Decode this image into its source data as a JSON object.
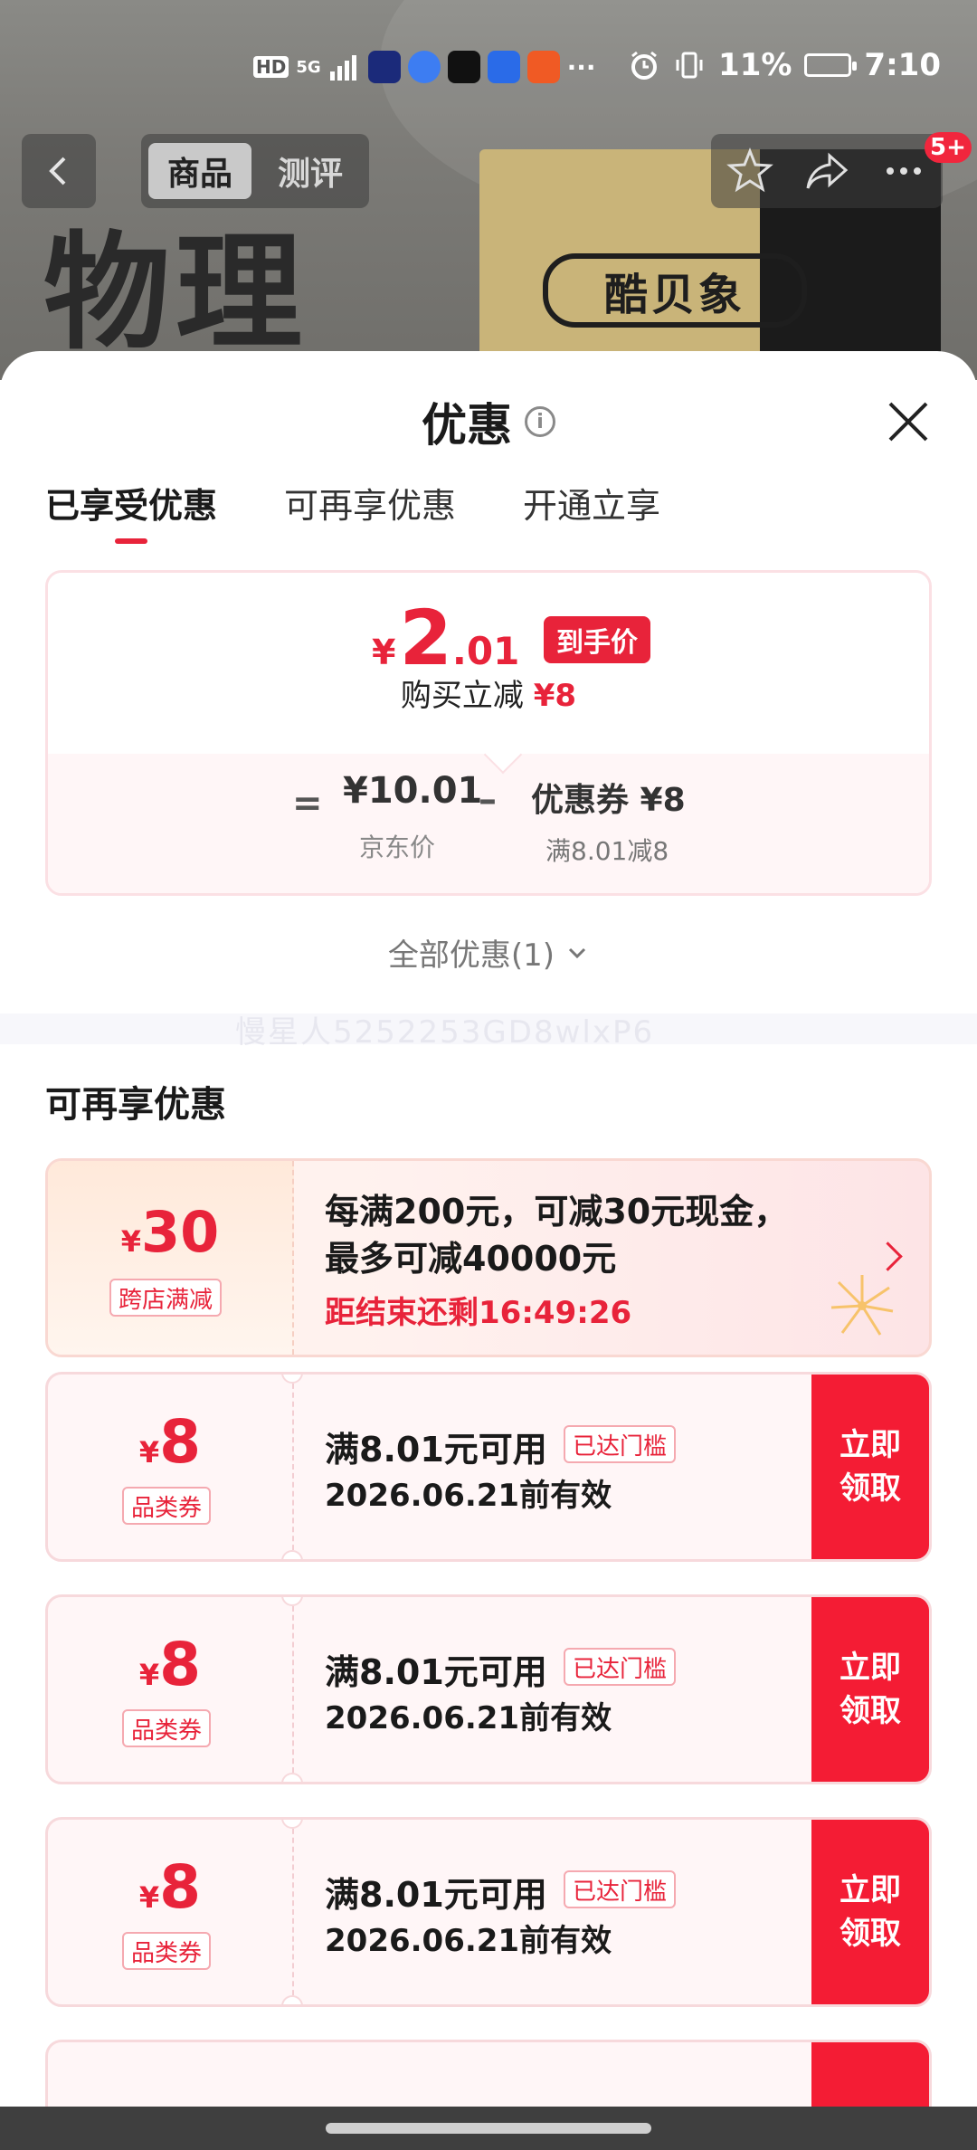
{
  "status_bar": {
    "network": "HD",
    "signal": "5G",
    "more": "···",
    "battery": "11%",
    "time": "7:10"
  },
  "product_nav": {
    "tabs": [
      "商品",
      "测评"
    ],
    "badge": "5+",
    "background_text": "物理",
    "background_brand": "酷贝象"
  },
  "sheet": {
    "title": "优惠",
    "tabs": [
      "已享受优惠",
      "可再享优惠",
      "开通立享"
    ],
    "price_card": {
      "final_yen": "¥",
      "final_int": "2",
      "final_dec": ".01",
      "final_tag": "到手价",
      "save_prefix": "购买立减",
      "save_amount": "¥8",
      "equals": "=",
      "jd_price": "¥10.01",
      "jd_label": "京东价",
      "minus": "–",
      "coupon_label": "优惠券 ¥8",
      "coupon_condition": "满8.01减8"
    },
    "all_offers": "全部优惠(1)",
    "watermark": "慢星人5252253GD8wlxP6",
    "section_title": "可再享优惠",
    "promo": {
      "yen": "¥",
      "amount": "30",
      "tag": "跨店满减",
      "line1": "每满200元，可减30元现金，",
      "line2": "最多可减40000元",
      "countdown": "距结束还剩16:49:26"
    },
    "coupons": [
      {
        "yen": "¥",
        "amount": "8",
        "type": "品类券",
        "condition": "满8.01元可用",
        "badge": "已达门槛",
        "date": "2026.06.21前有效",
        "button": "立即领取"
      },
      {
        "yen": "¥",
        "amount": "8",
        "type": "品类券",
        "condition": "满8.01元可用",
        "badge": "已达门槛",
        "date": "2026.06.21前有效",
        "button": "立即领取"
      },
      {
        "yen": "¥",
        "amount": "8",
        "type": "品类券",
        "condition": "满8.01元可用",
        "badge": "已达门槛",
        "date": "2026.06.21前有效",
        "button": "立即领取"
      }
    ]
  },
  "colors": {
    "accent": "#e8233a",
    "button": "#f41c34"
  }
}
